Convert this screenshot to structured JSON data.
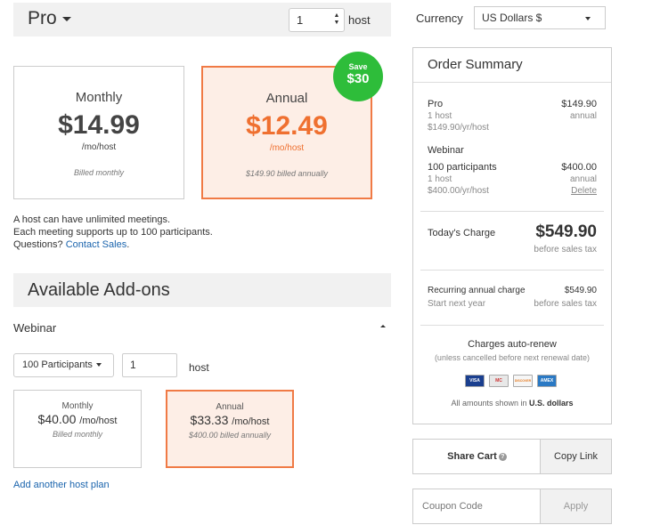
{
  "plan": {
    "name": "Pro",
    "host_qty": "1",
    "host_label": "host",
    "monthly": {
      "name": "Monthly",
      "price": "$14.99",
      "unit": "/mo/host",
      "billed": "Billed monthly"
    },
    "annual": {
      "name": "Annual",
      "price": "$12.49",
      "unit": "/mo/host",
      "billed": "$149.90 billed annually"
    },
    "save_badge": {
      "label": "Save",
      "amount": "$30"
    },
    "info_line1": "A host can have unlimited meetings.",
    "info_line2": "Each meeting supports up to 100 participants.",
    "info_q": "Questions?",
    "contact_sales": "Contact Sales",
    "info_end": "."
  },
  "addons": {
    "title": "Available Add-ons",
    "webinar": {
      "label": "Webinar",
      "participants": "100 Participants",
      "qty": "1",
      "host_label": "host",
      "monthly": {
        "name": "Monthly",
        "price": "$40.00",
        "unit": "/mo/host",
        "billed": "Billed monthly"
      },
      "annual": {
        "name": "Annual",
        "price": "$33.33",
        "unit": "/mo/host",
        "billed": "$400.00 billed annually"
      }
    },
    "add_plan": "Add another host plan"
  },
  "currency": {
    "label": "Currency",
    "value": "US Dollars $"
  },
  "summary": {
    "title": "Order Summary",
    "pro": {
      "name": "Pro",
      "price": "$149.90",
      "hosts": "1 host",
      "period": "annual",
      "rate": "$149.90/yr/host"
    },
    "webinar": {
      "name": "Webinar",
      "participants": "100 participants",
      "price": "$400.00",
      "hosts": "1 host",
      "period": "annual",
      "rate": "$400.00/yr/host",
      "delete": "Delete"
    },
    "todays_label": "Today's Charge",
    "todays_amount": "$549.90",
    "before_tax": "before sales tax",
    "recurring_label": "Recurring annual charge",
    "recurring_amount": "$549.90",
    "start": "Start next year",
    "recurring_tax": "before sales tax",
    "auto_renew": "Charges auto-renew",
    "auto_renew_note": "(unless cancelled before next renewal date)",
    "cards": [
      "VISA",
      "MC",
      "DISCOVER",
      "AMEX"
    ],
    "shown_prefix": "All amounts shown in ",
    "shown_currency": "U.S. dollars"
  },
  "actions": {
    "share_cart": "Share Cart",
    "copy_link": "Copy Link",
    "coupon_placeholder": "Coupon Code",
    "apply": "Apply"
  },
  "colors": {
    "accent": "#ef7030",
    "badge": "#2ebd3a",
    "link": "#1a64ad",
    "annual_bg": "#fdeee6"
  }
}
